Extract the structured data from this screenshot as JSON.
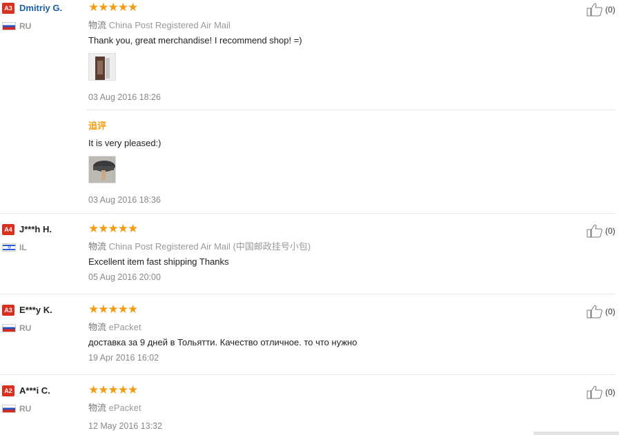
{
  "reviews": [
    {
      "badge": "A3",
      "name": "Dmitriy G.",
      "country": "RU",
      "rating": "★★★★★",
      "logistics_label": "物流",
      "logistics": "China Post Registered Air Mail",
      "text": "Thank you, great merchandise! I recommend shop! =)",
      "date": "03 Aug 2016 18:26",
      "followup_label": "追评",
      "followup_text": "It is very pleased:)",
      "followup_date": "03 Aug 2016 18:36",
      "likes": "(0)"
    },
    {
      "badge": "A4",
      "name": "J***h H.",
      "country": "IL",
      "rating": "★★★★★",
      "logistics_label": "物流",
      "logistics": "China Post Registered Air Mail (中国邮政挂号小包)",
      "text": "Excellent item fast shipping Thanks",
      "date": "05 Aug 2016 20:00",
      "likes": "(0)"
    },
    {
      "badge": "A3",
      "name": "E***y K.",
      "country": "RU",
      "rating": "★★★★★",
      "logistics_label": "物流",
      "logistics": "ePacket",
      "text": "доставка за 9 дней в Тольятти. Качество отличное. то что нужно",
      "date": "19 Apr 2016 16:02",
      "likes": "(0)"
    },
    {
      "badge": "A2",
      "name": "A***i C.",
      "country": "RU",
      "rating": "★★★★★",
      "logistics_label": "物流",
      "logistics": "ePacket",
      "date": "12 May 2016 13:32",
      "likes": "(0)"
    }
  ],
  "icons": {
    "like": "thumbs-up-icon",
    "star": "star-icon"
  },
  "colors": {
    "badge": "#d9301f",
    "stars": "#f39c12",
    "name_link": "#1a5ea8",
    "followup": "#f39c12"
  }
}
